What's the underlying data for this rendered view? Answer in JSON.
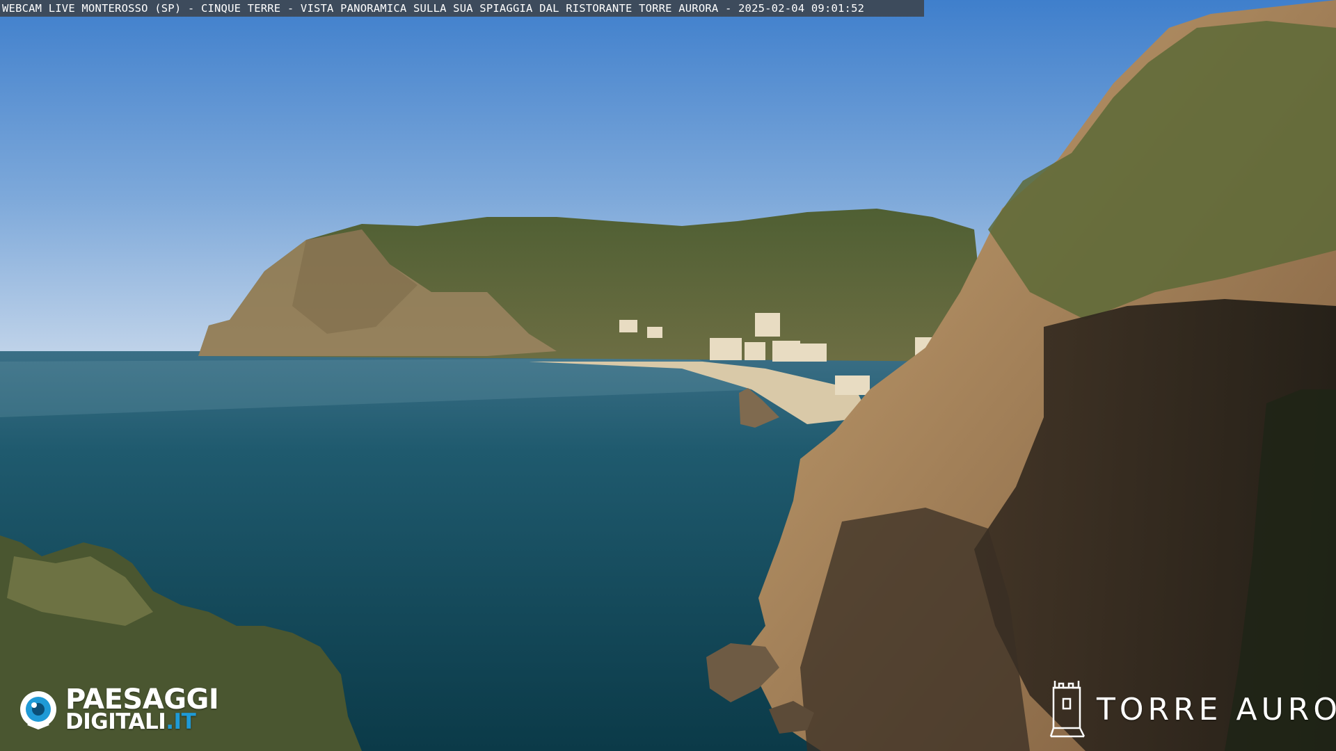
{
  "overlay": {
    "caption": "WEBCAM LIVE MONTEROSSO (SP) - CINQUE TERRE - VISTA PANORAMICA SULLA SUA SPIAGGIA DAL RISTORANTE TORRE AURORA - 2025-02-04 09:01:52"
  },
  "logos": {
    "paesaggi_line1": "PAESAGGI",
    "paesaggi_line2_main": "DIGITALI",
    "paesaggi_line2_tld": ".IT",
    "torre_aurora": "TORRE AURORA",
    "paesaggi_icon": "eye-logo-icon",
    "torre_icon": "tower-logo-icon"
  },
  "colors": {
    "sky_top": "#4a86cf",
    "sky_bottom": "#b9cfe6",
    "sea_deep": "#0e4a5e",
    "sea_light": "#2b7187",
    "hills": "#5a6b3b",
    "cliff": "#c09a6a",
    "logo_accent": "#1f9ad6"
  }
}
